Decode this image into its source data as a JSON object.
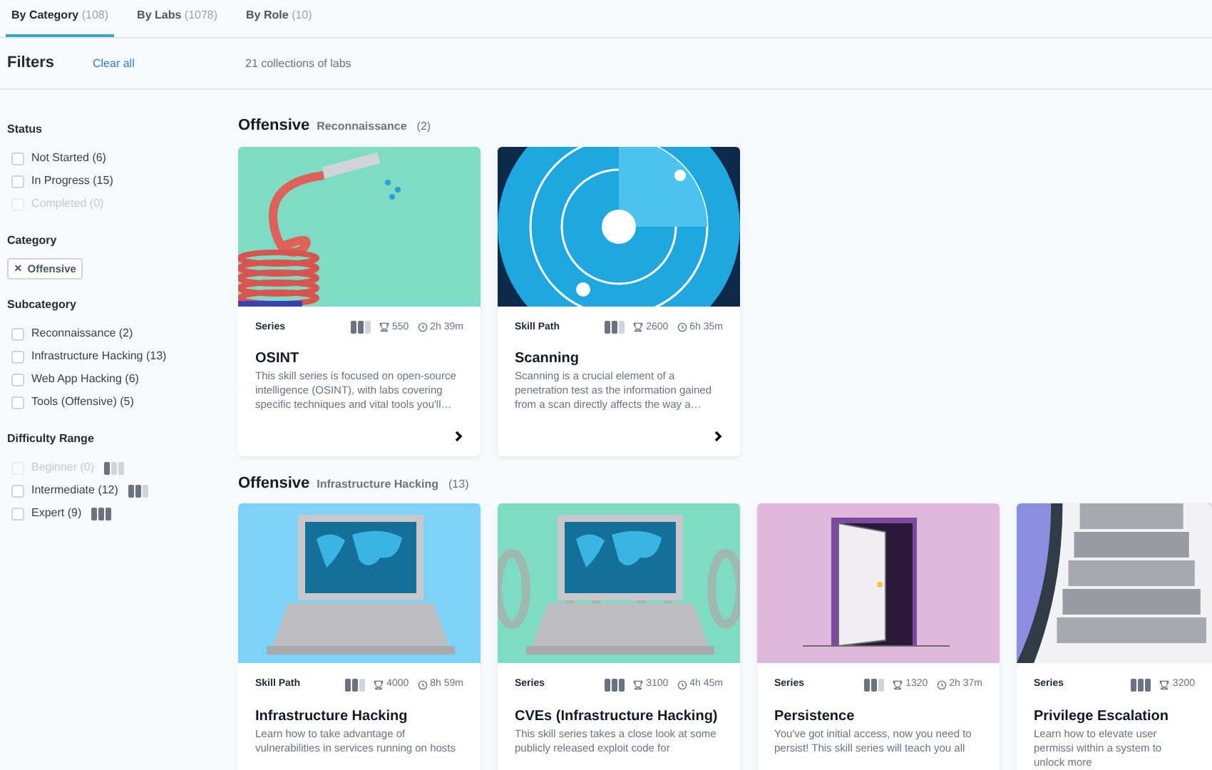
{
  "tabs": [
    {
      "label": "By Category",
      "count": "(108)",
      "selected": true
    },
    {
      "label": "By Labs",
      "count": "(1078)",
      "selected": false
    },
    {
      "label": "By Role",
      "count": "(10)",
      "selected": false
    }
  ],
  "filters": {
    "title": "Filters",
    "clear": "Clear all",
    "summary": "21 collections of labs",
    "groups": [
      {
        "title": "Status",
        "kind": "checkboxes",
        "items": [
          {
            "label": "Not Started (6)",
            "checked": false,
            "disabled": false
          },
          {
            "label": "In Progress (15)",
            "checked": false,
            "disabled": false
          },
          {
            "label": "Completed (0)",
            "checked": false,
            "disabled": true
          }
        ]
      },
      {
        "title": "Category",
        "kind": "chips",
        "items": [
          {
            "label": "Offensive",
            "remove": "×"
          }
        ]
      },
      {
        "title": "Subcategory",
        "kind": "checkboxes",
        "items": [
          {
            "label": "Reconnaissance (2)",
            "checked": false,
            "disabled": false
          },
          {
            "label": "Infrastructure Hacking (13)",
            "checked": false,
            "disabled": false
          },
          {
            "label": "Web App Hacking (6)",
            "checked": false,
            "disabled": false
          },
          {
            "label": "Tools (Offensive) (5)",
            "checked": false,
            "disabled": false
          }
        ]
      },
      {
        "title": "Difficulty Range",
        "kind": "checkboxes",
        "items": [
          {
            "label": "Beginner (0)",
            "checked": false,
            "disabled": true,
            "level": 0.33
          },
          {
            "label": "Intermediate (12)",
            "checked": false,
            "disabled": false,
            "level": 0.67
          },
          {
            "label": "Expert (9)",
            "checked": false,
            "disabled": false,
            "level": 1
          }
        ]
      }
    ]
  },
  "sections": [
    {
      "title": "Offensive",
      "subtitle": "Reconnaissance",
      "count": "(2)",
      "cards": [
        {
          "type": "Series",
          "level": 0.67,
          "points": "550",
          "time": "2h 39m",
          "title": "OSINT",
          "description": "This skill series is focused on open-source intelligence (OSINT), with labs covering specific techniques and vital tools you'll…",
          "arrow": true
        },
        {
          "type": "Skill Path",
          "level": 0.67,
          "points": "2600",
          "time": "6h 35m",
          "title": "Scanning",
          "description": "Scanning is a crucial element of a penetration test as the information gained from a scan directly affects the way a…",
          "arrow": true
        }
      ]
    },
    {
      "title": "Offensive",
      "subtitle": "Infrastructure Hacking",
      "count": "(13)",
      "cards": [
        {
          "type": "Skill Path",
          "level": 0.67,
          "points": "4000",
          "time": "8h 59m",
          "title": "Infrastructure Hacking",
          "description": "Learn how to take advantage of vulnerabilities in services running on hosts"
        },
        {
          "type": "Series",
          "level": 1,
          "points": "3100",
          "time": "4h 45m",
          "title": "CVEs (Infrastructure Hacking)",
          "description": "This skill series takes a close look at some publicly released exploit code for"
        },
        {
          "type": "Series",
          "level": 0.67,
          "points": "1320",
          "time": "2h 37m",
          "title": "Persistence",
          "description": "You've got initial access, now you need to persist! This skill series will teach you all"
        },
        {
          "type": "Series",
          "level": 1,
          "points": "3200",
          "title": "Privilege Escalation",
          "description": "Learn how to elevate user permissi within a system to unlock more"
        }
      ]
    }
  ]
}
